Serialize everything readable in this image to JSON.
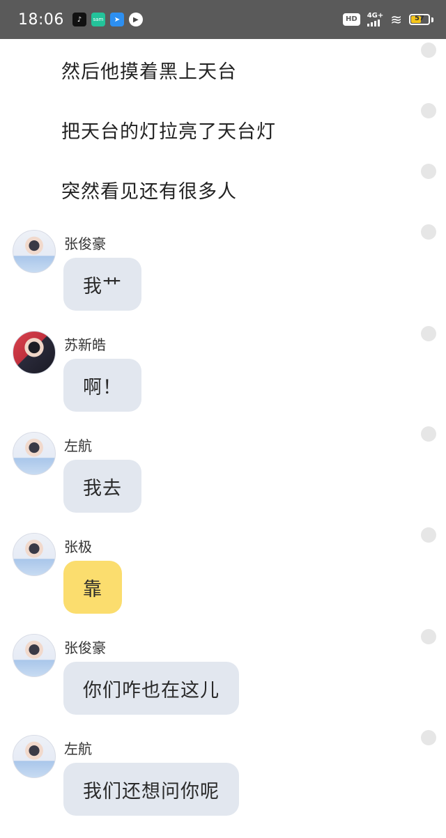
{
  "status_bar": {
    "time": "18:06",
    "apps": [
      "tiktok-icon",
      "soul-icon",
      "send-icon",
      "play-icon"
    ],
    "soul_label": "sam",
    "hd": "HD",
    "network": "4G+",
    "battery_level": "57",
    "battery_fraction": 0.57
  },
  "narration": [
    "然后他摸着黑上天台",
    "把天台的灯拉亮了天台灯",
    "突然看见还有很多人"
  ],
  "messages": [
    {
      "name": "张俊豪",
      "text": "我艹",
      "avatar": "light"
    },
    {
      "name": "苏新皓",
      "text": "啊！",
      "avatar": "dark"
    },
    {
      "name": "左航",
      "text": "我去",
      "avatar": "light"
    },
    {
      "name": "张极",
      "text": "靠",
      "avatar": "light",
      "bubble_color": "#fbdd6e"
    },
    {
      "name": "张俊豪",
      "text": "你们咋也在这儿",
      "avatar": "light"
    },
    {
      "name": "左航",
      "text": "我们还想问你呢",
      "avatar": "light"
    }
  ],
  "colors": {
    "status_bar_bg": "#5a5a5a",
    "bubble_default": "#e2e7ef",
    "bubble_highlight": "#fbdd6e",
    "dot": "#e6e6e6"
  }
}
